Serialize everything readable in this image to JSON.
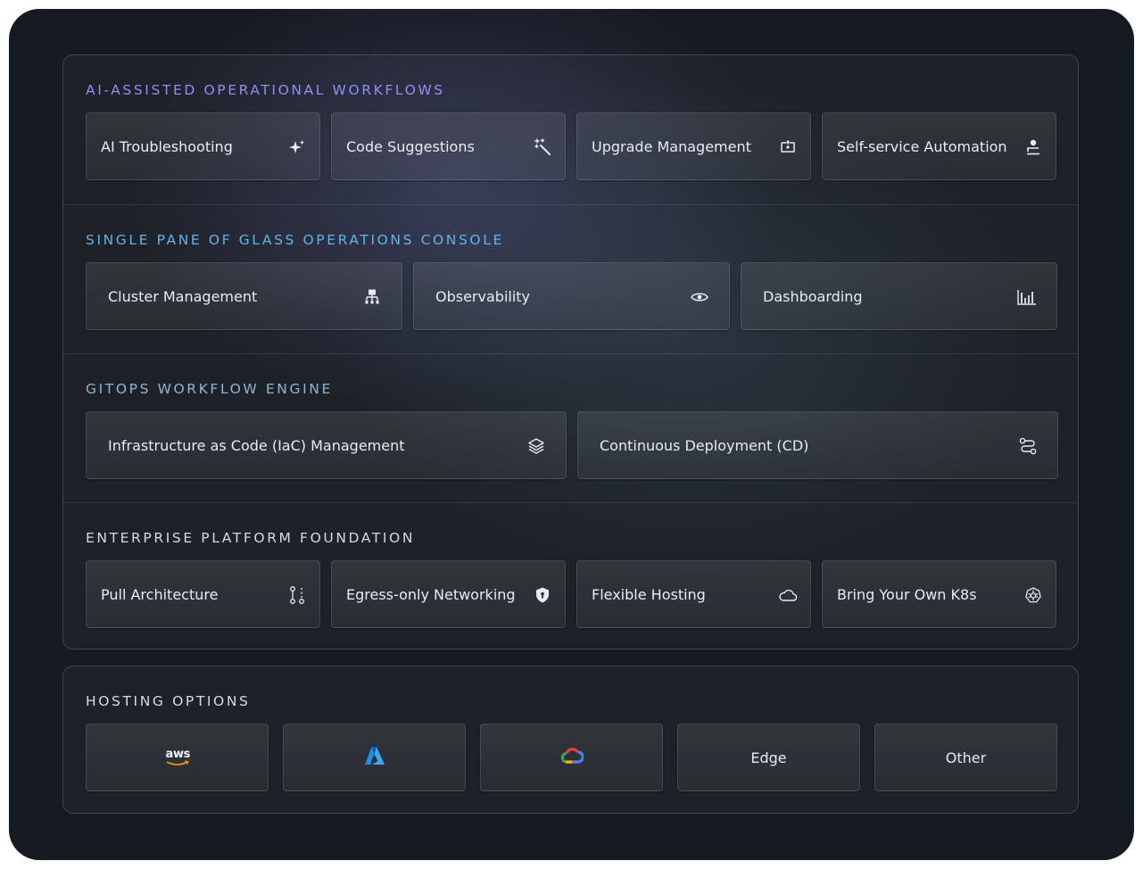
{
  "sections": [
    {
      "title": "AI-ASSISTED OPERATIONAL WORKFLOWS",
      "title_color": "#8f8df7",
      "cards": [
        {
          "label": "AI Troubleshooting",
          "icon": "sparkles-icon"
        },
        {
          "label": "Code Suggestions",
          "icon": "magic-wand-icon"
        },
        {
          "label": "Upgrade Management",
          "icon": "upgrade-icon"
        },
        {
          "label": "Self-service Automation",
          "icon": "user-desk-icon"
        }
      ]
    },
    {
      "title": "SINGLE PANE OF GLASS OPERATIONS CONSOLE",
      "title_color": "#5fb2ea",
      "cards": [
        {
          "label": "Cluster Management",
          "icon": "cluster-icon"
        },
        {
          "label": "Observability",
          "icon": "eye-icon"
        },
        {
          "label": "Dashboarding",
          "icon": "bar-chart-icon"
        }
      ]
    },
    {
      "title": "GITOPS WORKFLOW ENGINE",
      "title_color": "#8fb4d0",
      "cards": [
        {
          "label": "Infrastructure as Code (IaC) Management",
          "icon": "layers-icon"
        },
        {
          "label": "Continuous Deployment (CD)",
          "icon": "route-icon"
        }
      ]
    },
    {
      "title": "ENTERPRISE PLATFORM FOUNDATION",
      "title_color": "#d6dae0",
      "cards": [
        {
          "label": "Pull Architecture",
          "icon": "git-pull-icon"
        },
        {
          "label": "Egress-only Networking",
          "icon": "shield-icon"
        },
        {
          "label": "Flexible Hosting",
          "icon": "cloud-icon"
        },
        {
          "label": "Bring Your Own K8s",
          "icon": "kubernetes-icon"
        }
      ]
    }
  ],
  "hosting": {
    "title": "HOSTING OPTIONS",
    "title_color": "#d6dae0",
    "options": [
      {
        "name": "aws",
        "icon": "aws-logo",
        "text": "aws"
      },
      {
        "name": "azure",
        "icon": "azure-logo",
        "text": ""
      },
      {
        "name": "google-cloud",
        "icon": "google-cloud-logo",
        "text": ""
      },
      {
        "name": "edge",
        "icon": "",
        "text": "Edge"
      },
      {
        "name": "other",
        "icon": "",
        "text": "Other"
      }
    ]
  }
}
